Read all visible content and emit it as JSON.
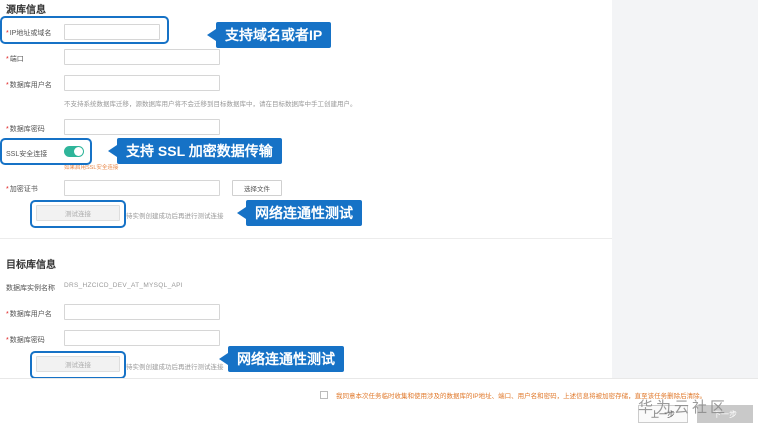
{
  "source_section": {
    "title": "源库信息",
    "ip_label": "IP地址或域名",
    "port_label": "端口",
    "user_label": "数据库用户名",
    "user_hint": "不支持系统数据库迁移，源数据库用户将不会迁移到目标数据库中，请在目标数据库中手工创建用户。",
    "password_label": "数据库密码",
    "ssl_label": "SSL安全连接",
    "ssl_note": "如果启用SSL安全连接",
    "ssl_enabled": true,
    "cert_label": "加密证书",
    "choose_file_label": "选择文件",
    "test_button_label": "测试连接",
    "test_hint": "待实例创建成功后再进行测试连接"
  },
  "target_section": {
    "title": "目标库信息",
    "instance_label": "数据库实例名称",
    "instance_value": "DRS_HZCICD_DEV_AT_MYSQL_API",
    "user_label": "数据库用户名",
    "password_label": "数据库密码",
    "test_button_label": "测试连接",
    "test_hint": "待实例创建成功后再进行测试连接"
  },
  "callouts": {
    "domain_ip": "支持域名或者IP",
    "ssl": "支持 SSL 加密数据传输",
    "test_source": "网络连通性测试",
    "test_target": "网络连通性测试"
  },
  "footer": {
    "agreement_text": "我同意本次任务临时收集和使用涉及的数据库的IP地址、端口、用户名和密码，上述信息将被加密存储，直至该任务删除后清除。",
    "prev_label": "上一步",
    "next_label": "下一步"
  },
  "watermark": "华为云社区",
  "colors": {
    "accent": "#1672c6",
    "toggle_on": "#2fb59a",
    "required": "#e02020",
    "notice": "#e0782a"
  }
}
